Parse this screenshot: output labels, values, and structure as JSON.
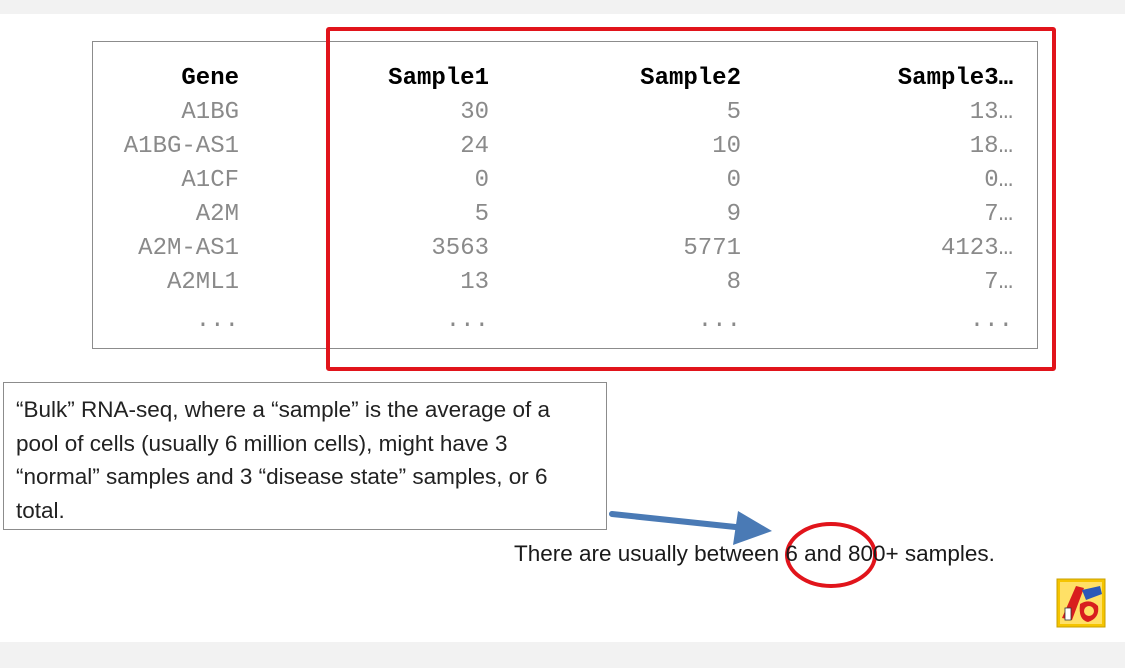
{
  "table": {
    "headers": [
      "Gene",
      "Sample1",
      "Sample2",
      "Sample3…"
    ],
    "rows": [
      [
        "A1BG",
        "30",
        "5",
        "13…"
      ],
      [
        "A1BG-AS1",
        "24",
        "10",
        "18…"
      ],
      [
        "A1CF",
        "0",
        "0",
        "0…"
      ],
      [
        "A2M",
        "5",
        "9",
        "7…"
      ],
      [
        "A2M-AS1",
        "3563",
        "5771",
        "4123…"
      ],
      [
        "A2ML1",
        "13",
        "8",
        "7…"
      ],
      [
        "...",
        "...",
        "...",
        "..."
      ]
    ]
  },
  "note": {
    "text": "“Bulk” RNA-seq, where a “sample” is the average of a pool of cells (usually 6 million cells), might have 3 “normal” samples and 3 “disease state” samples, or 6 total."
  },
  "summary": {
    "text": "There are usually between 6 and 800+ samples."
  },
  "colors": {
    "highlight": "#e1141b",
    "arrow": "#4a7ab5",
    "logo_yellow": "#f5c400",
    "logo_red": "#d81e1e"
  },
  "icons": {
    "arrow": "arrow-right-icon",
    "logo": "statquest-logo-icon"
  }
}
